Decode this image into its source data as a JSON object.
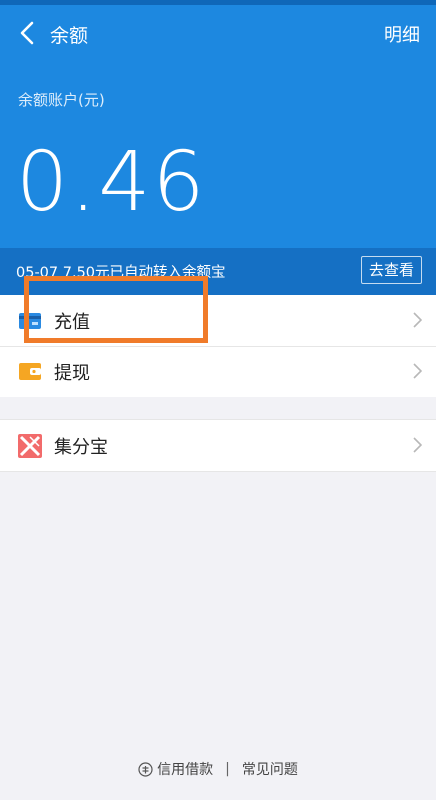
{
  "nav": {
    "title": "余额",
    "detail": "明细"
  },
  "account": {
    "label": "余额账户(元)",
    "amount": "0.46"
  },
  "notice": {
    "text": "05-07 7.50元已自动转入余额宝",
    "button": "去查看"
  },
  "menu": [
    {
      "label": "充值",
      "icon": "card-icon"
    },
    {
      "label": "提现",
      "icon": "wallet-icon"
    }
  ],
  "menu2": [
    {
      "label": "集分宝",
      "icon": "jifenbao-icon"
    }
  ],
  "footer": {
    "credit": "信用借款",
    "separator": "|",
    "faq": "常见问题"
  },
  "colors": {
    "header_blue": "#1d88e0",
    "notice_blue": "#1570c4",
    "highlight_orange": "#f07b2a"
  }
}
